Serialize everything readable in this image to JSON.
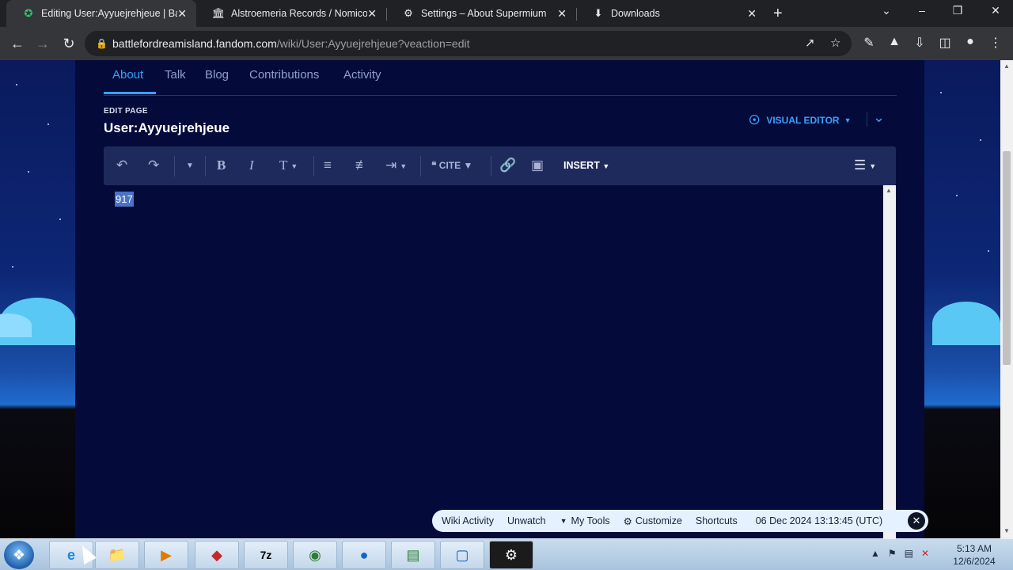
{
  "browser": {
    "tabs": [
      {
        "label": "Editing User:Ayyuejrehjeue | Batt",
        "icon": "fandom-icon",
        "active": true
      },
      {
        "label": "Alstroemeria Records / Nomico",
        "icon": "bank-icon",
        "active": false
      },
      {
        "label": "Settings – About Supermium",
        "icon": "gear-icon",
        "active": false
      },
      {
        "label": "Downloads",
        "icon": "download-icon",
        "active": false
      }
    ],
    "url_host": "battlefordreamisland.fandom.com",
    "url_path": "/wiki/User:Ayyuejrehjeue?veaction=edit"
  },
  "page": {
    "nav_tabs": [
      "About",
      "Talk",
      "Blog",
      "Contributions",
      "Activity"
    ],
    "edit_label": "EDIT PAGE",
    "title": "User:Ayyuejrehjeue",
    "editor_mode": "VISUAL EDITOR",
    "toolbar": {
      "cite_label": "CITE",
      "insert_label": "INSERT"
    },
    "editor_content": "917"
  },
  "wiki_bar": {
    "items": [
      "Wiki Activity",
      "Unwatch",
      "My Tools",
      "Customize",
      "Shortcuts"
    ],
    "timestamp": "06 Dec 2024 13:13:45 (UTC)"
  },
  "taskbar": {
    "time": "5:13 AM",
    "date": "12/6/2024"
  },
  "colors": {
    "accent": "#3aa0ff",
    "page_bg": "#040b3a",
    "toolbar_bg": "#1f2a5c"
  }
}
